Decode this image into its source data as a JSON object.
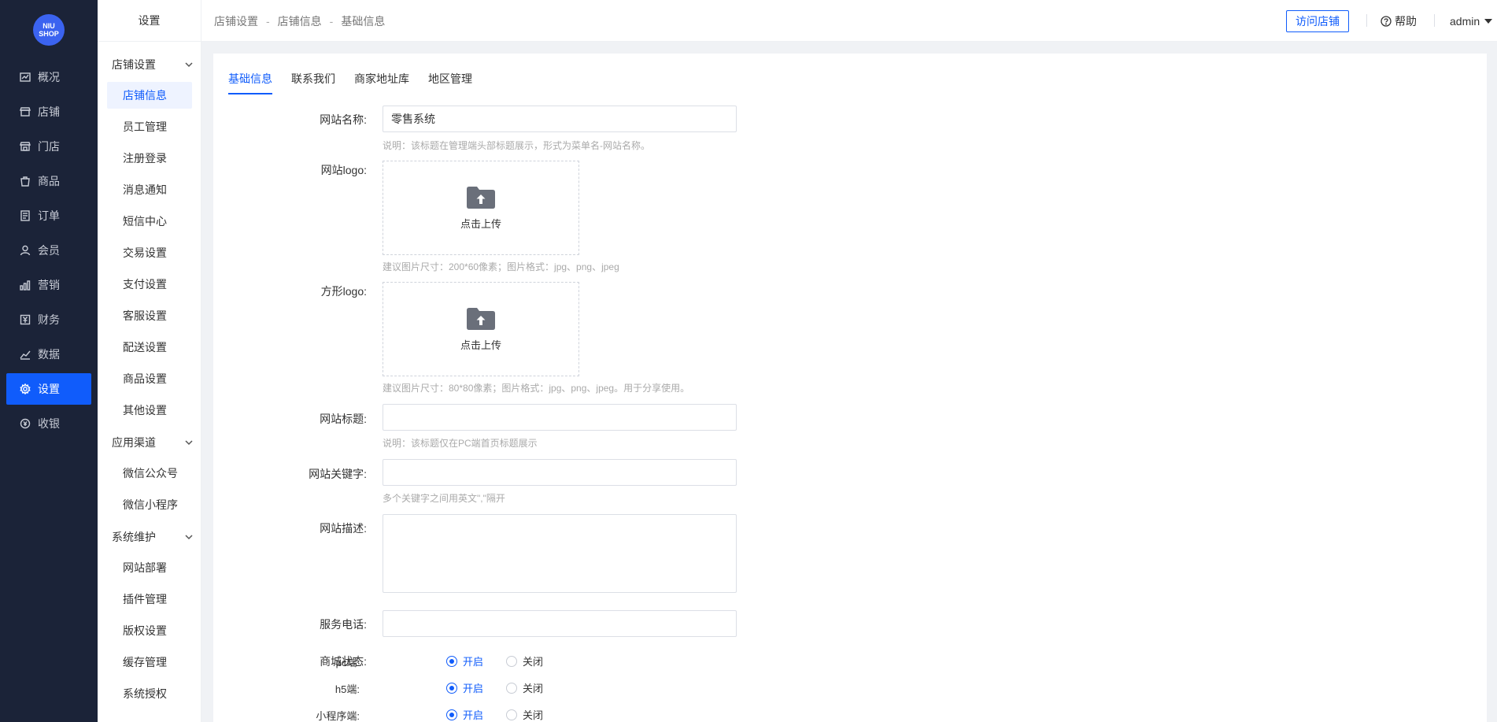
{
  "brand": {
    "logo_text": "NIU SHOP",
    "accent": "#105cfb",
    "sidebar_bg": "#1b2338"
  },
  "main_nav": [
    {
      "label": "概况",
      "icon": "chart-icon"
    },
    {
      "label": "店铺",
      "icon": "store-icon"
    },
    {
      "label": "门店",
      "icon": "shop-icon"
    },
    {
      "label": "商品",
      "icon": "goods-icon"
    },
    {
      "label": "订单",
      "icon": "order-icon"
    },
    {
      "label": "会员",
      "icon": "user-icon"
    },
    {
      "label": "营销",
      "icon": "marketing-icon"
    },
    {
      "label": "财务",
      "icon": "finance-icon"
    },
    {
      "label": "数据",
      "icon": "data-icon"
    },
    {
      "label": "设置",
      "icon": "gear-icon",
      "active": true
    },
    {
      "label": "收银",
      "icon": "cashier-icon"
    }
  ],
  "sub_nav": {
    "title": "设置",
    "groups": [
      {
        "label": "店铺设置",
        "items": [
          "店铺信息",
          "员工管理",
          "注册登录",
          "消息通知",
          "短信中心",
          "交易设置",
          "支付设置",
          "客服设置",
          "配送设置",
          "商品设置",
          "其他设置"
        ]
      },
      {
        "label": "应用渠道",
        "items": [
          "微信公众号",
          "微信小程序"
        ]
      },
      {
        "label": "系统维护",
        "items": [
          "网站部署",
          "插件管理",
          "版权设置",
          "缓存管理",
          "系统授权"
        ]
      }
    ],
    "active_item": "店铺信息"
  },
  "header": {
    "breadcrumb": [
      "店铺设置",
      "店铺信息",
      "基础信息"
    ],
    "breadcrumb_sep": "-",
    "visit_store": "访问店铺",
    "help": "帮助",
    "user": "admin"
  },
  "tabs": [
    {
      "label": "基础信息",
      "active": true
    },
    {
      "label": "联系我们"
    },
    {
      "label": "商家地址库"
    },
    {
      "label": "地区管理"
    }
  ],
  "form": {
    "site_name": {
      "label": "网站名称:",
      "value": "零售系统",
      "hint": "说明：该标题在管理端头部标题展示，形式为菜单名-网站名称。"
    },
    "site_logo": {
      "label": "网站logo:",
      "upload_text": "点击上传",
      "hint": "建议图片尺寸：200*60像素；图片格式：jpg、png、jpeg"
    },
    "square_logo": {
      "label": "方形logo:",
      "upload_text": "点击上传",
      "hint": "建议图片尺寸：80*80像素；图片格式：jpg、png、jpeg。用于分享使用。"
    },
    "site_title": {
      "label": "网站标题:",
      "value": "",
      "hint": "说明：该标题仅在PC端首页标题展示"
    },
    "keywords": {
      "label": "网站关键字:",
      "value": "",
      "hint": "多个关键字之间用英文\",\"隔开"
    },
    "description": {
      "label": "网站描述:",
      "value": ""
    },
    "service_phone": {
      "label": "服务电话:",
      "value": ""
    },
    "mall_status": {
      "label": "商城状态:",
      "on_label": "开启",
      "off_label": "关闭",
      "rows": [
        {
          "label": "pc端:",
          "on": true
        },
        {
          "label": "h5端:",
          "on": true
        },
        {
          "label": "小程序端:",
          "on": true
        }
      ]
    }
  }
}
